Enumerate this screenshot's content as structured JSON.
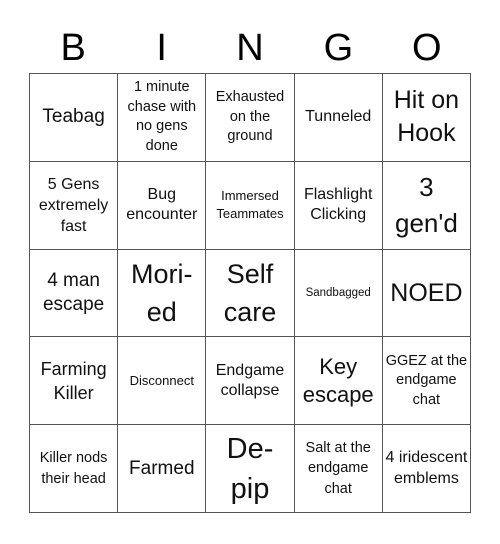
{
  "header": {
    "letters": [
      "B",
      "I",
      "N",
      "G",
      "O"
    ]
  },
  "board": {
    "cells": [
      [
        "Teabag",
        "1 minute chase with no gens done",
        "Exhausted on the ground",
        "Tunneled",
        "Hit on Hook"
      ],
      [
        "5 Gens extremely fast",
        "Bug encounter",
        "Immersed Teammates",
        "Flashlight Clicking",
        "3 gen'd"
      ],
      [
        "4 man escape",
        "Mori-ed",
        "Self care",
        "Sandbagged",
        "NOED"
      ],
      [
        "Farming Killer",
        "Disconnect",
        "Endgame collapse",
        "Key escape",
        "GGEZ at the endgame chat"
      ],
      [
        "Killer nods their head",
        "Farmed",
        "De-pip",
        "Salt at the endgame chat",
        "4 iridescent emblems"
      ]
    ]
  }
}
